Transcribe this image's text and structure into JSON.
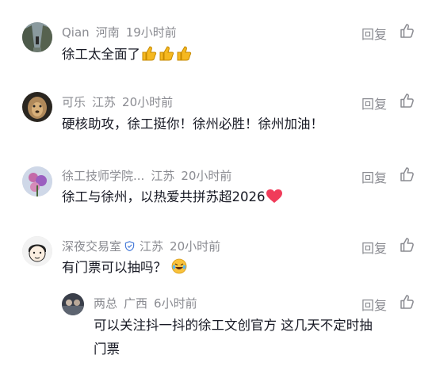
{
  "actions": {
    "reply_label": "回复"
  },
  "comments": [
    {
      "username": "Qian",
      "location": "河南",
      "time": "19小时前",
      "text": "徐工太全面了"
    },
    {
      "username": "可乐",
      "location": "江苏",
      "time": "20小时前",
      "text": "硬核助攻，徐工挺你！徐州必胜！徐州加油！"
    },
    {
      "username": "徐工技师学院...",
      "location": "江苏",
      "time": "20小时前",
      "text": "徐工与徐州，以热爱共拼苏超2026"
    },
    {
      "username": "深夜交易室",
      "location": "江苏",
      "time": "20小时前",
      "text": "有门票可以抽吗？"
    }
  ],
  "reply": {
    "username": "两总",
    "location": "广西",
    "time": "6小时前",
    "text_line1": "可以关注抖一抖的徐工文创官方 这几天不定时抽",
    "text_line2": "门票"
  },
  "icons": {
    "like": "thumbs-up-outline-icon",
    "verified": "shield-check-icon",
    "emoji_thumbs": "thumbs-up-emoji",
    "emoji_heart": "red-heart-emoji",
    "emoji_laugh": "laughing-tears-emoji"
  },
  "colors": {
    "meta_gray": "#8a8b91",
    "text_dark": "#161823",
    "heart_red": "#f03c5a",
    "verified_blue": "#4a7dd9"
  }
}
